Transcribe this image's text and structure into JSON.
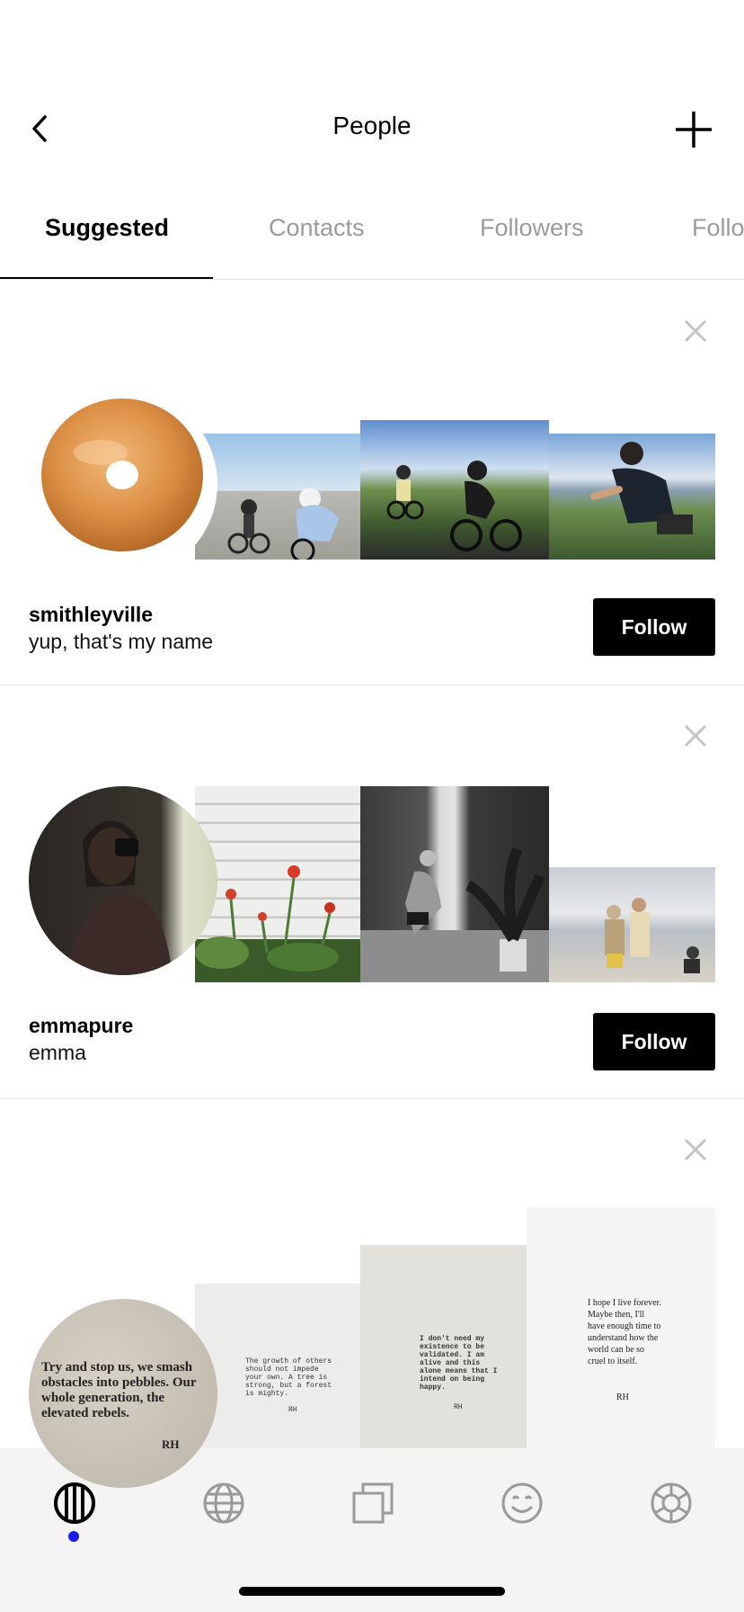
{
  "header": {
    "title": "People"
  },
  "tabs": [
    {
      "label": "Suggested",
      "active": true
    },
    {
      "label": "Contacts",
      "active": false
    },
    {
      "label": "Followers",
      "active": false
    },
    {
      "label": "Follo",
      "active": false
    }
  ],
  "suggestions": [
    {
      "username": "smithleyville",
      "display_name": "yup, that's my name",
      "follow_label": "Follow"
    },
    {
      "username": "emmapure",
      "display_name": "emma",
      "follow_label": "Follow"
    },
    {
      "avatar_text": "Try and stop us, we smash obstacles into pebbles. Our whole generation, the elevated rebels.",
      "avatar_signature": "RH",
      "photos_text": [
        {
          "text": "The growth of others should not impede your own. A tree is strong, but a forest is mighty.",
          "signature": "RH"
        },
        {
          "text": "I don't need my existence to be validated. I am alive and this alone means that I intend on being happy.",
          "signature": "RH"
        },
        {
          "text": "I hope I live forever. Maybe then, I'll have enough time to understand how the world can be so cruel to itself.",
          "signature": "RH"
        }
      ]
    }
  ],
  "bottom_nav": {
    "items": [
      "feed-icon",
      "globe-icon",
      "collections-icon",
      "smiley-icon",
      "settings-icon"
    ],
    "active_index": 0,
    "active_color": "#1a1aee"
  }
}
